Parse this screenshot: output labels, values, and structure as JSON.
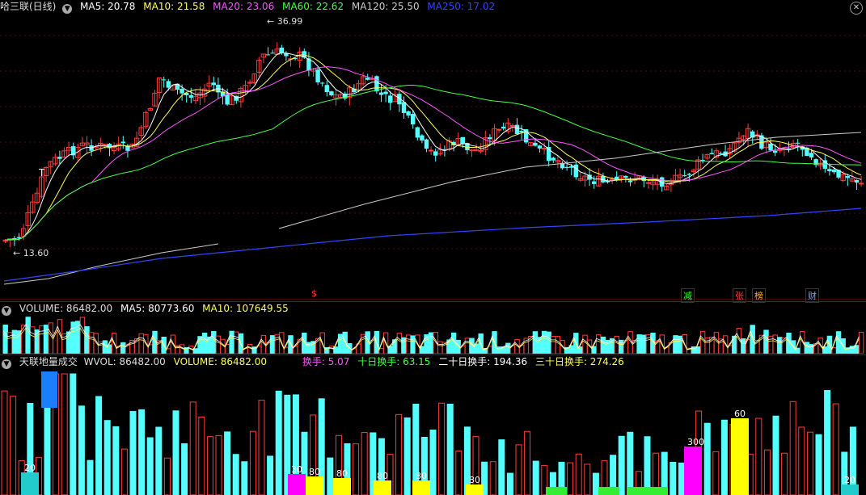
{
  "main": {
    "title": "哈三联(日线)",
    "ma": [
      {
        "label": "MA5: 20.78",
        "color": "#ffffff"
      },
      {
        "label": "MA10: 21.58",
        "color": "#ffff55"
      },
      {
        "label": "MA20: 23.06",
        "color": "#ff55ff"
      },
      {
        "label": "MA60: 22.62",
        "color": "#44ff44"
      },
      {
        "label": "MA120: 25.50",
        "color": "#cccccc"
      },
      {
        "label": "MA250: 17.02",
        "color": "#3344ff"
      }
    ],
    "high_label": "36.99",
    "low_label": "13.60",
    "t_label": "T",
    "markers": [
      {
        "text": "$",
        "color": "#ff3333"
      },
      {
        "text": "减",
        "color": "#33ff33"
      },
      {
        "text": "张",
        "color": "#ff3333"
      },
      {
        "text": "榜",
        "color": "#ffaa33"
      },
      {
        "text": "财",
        "color": "#66aaff"
      }
    ],
    "close_icon": "close-icon"
  },
  "volume": {
    "title": "VOLUME: 86482.00",
    "ma5": "MA5: 80773.60",
    "ma10": "MA10: 107649.55"
  },
  "wvol": {
    "title": "天联地量成交",
    "wvol": "WVOL: 86482.00",
    "volume": "VOLUME: 86482.00",
    "turnover": "换手: 5.07",
    "turnover10": "十日换手: 63.15",
    "turnover20": "二十日换手: 194.36",
    "turnover30": "三十日换手: 274.26",
    "labels": [
      "20",
      "30",
      "80",
      "80",
      "80",
      "80",
      "80",
      "300",
      "60",
      "20"
    ]
  },
  "colors": {
    "up": "#ff3b3b",
    "down": "#54ffff",
    "grid": "#8a1010"
  }
}
